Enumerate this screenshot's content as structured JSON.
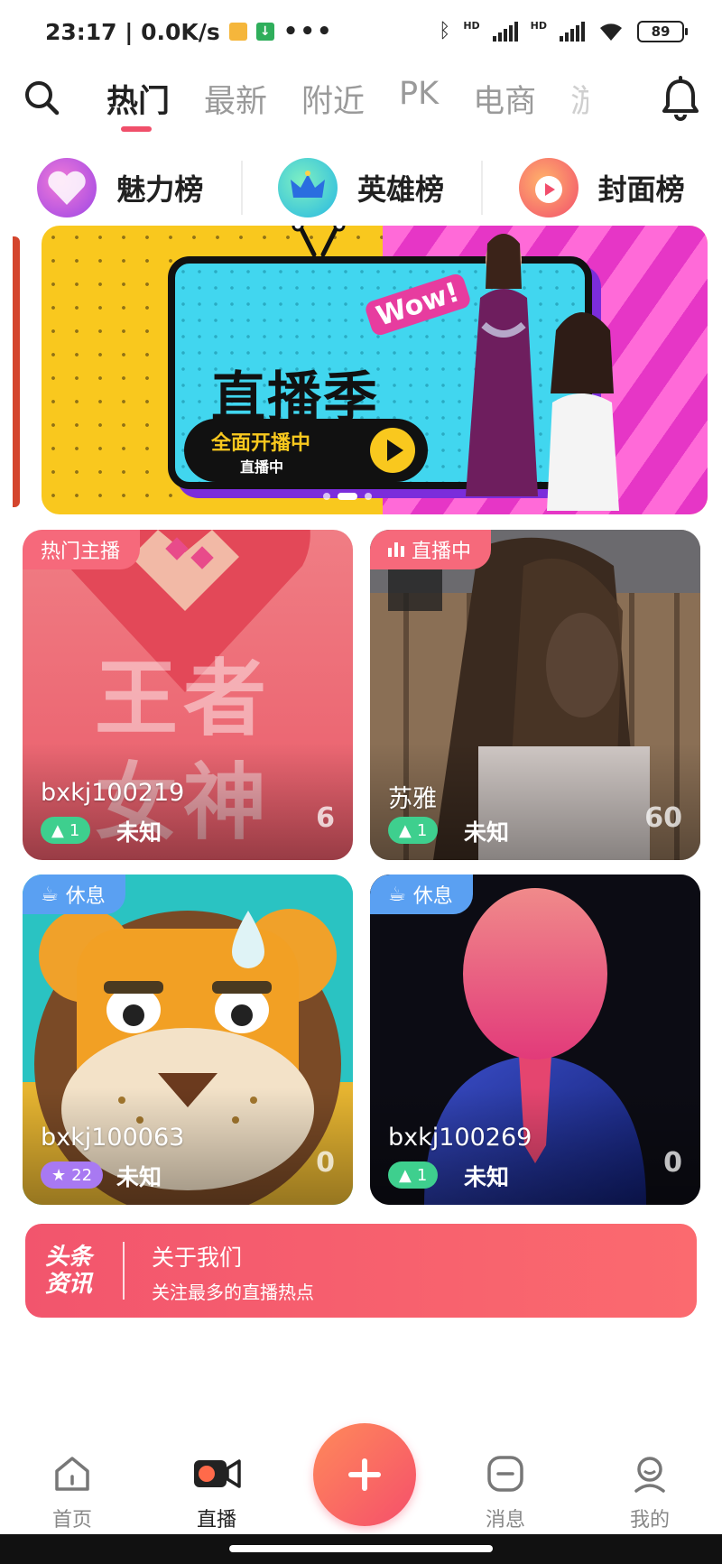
{
  "status_bar": {
    "time_speed": "23:17 | 0.0K/s",
    "hd1": "HD",
    "hd2": "HD",
    "battery": "89"
  },
  "top_tabs": [
    {
      "label": "热门",
      "active": true
    },
    {
      "label": "最新"
    },
    {
      "label": "附近"
    },
    {
      "label": "PK"
    },
    {
      "label": "电商"
    },
    {
      "label": "游"
    }
  ],
  "rank_bar": [
    {
      "label": "魅力榜",
      "icon": "heart-icon"
    },
    {
      "label": "英雄榜",
      "icon": "crown-icon"
    },
    {
      "label": "封面榜",
      "icon": "play-icon"
    }
  ],
  "banner": {
    "wow": "Wow!",
    "title": "直播季",
    "pill_main": "全面开播中",
    "pill_sub": "直播中"
  },
  "cards": [
    {
      "tag": "热门主播",
      "tag_type": "hot",
      "name": "bxkj100219",
      "level": "1",
      "location": "未知",
      "count": "6",
      "art_text_line1": "王者",
      "art_text_line2": "女神"
    },
    {
      "tag": "直播中",
      "tag_type": "hot",
      "name": "苏雅",
      "level": "1",
      "location": "未知",
      "count": "60"
    },
    {
      "tag": "休息",
      "tag_type": "rest",
      "name": "bxkj100063",
      "level": "22",
      "location": "未知",
      "count": "0"
    },
    {
      "tag": "休息",
      "tag_type": "rest",
      "name": "bxkj100269",
      "level": "1",
      "location": "未知",
      "count": "0"
    }
  ],
  "news": {
    "logo_line1": "头条",
    "logo_line2": "资讯",
    "title": "关于我们",
    "subtitle": "关注最多的直播热点"
  },
  "bottom_nav": [
    {
      "label": "首页"
    },
    {
      "label": "直播",
      "active": true
    },
    {
      "label": "消息"
    },
    {
      "label": "我的"
    }
  ],
  "colors": {
    "accent": "#f04f6a",
    "news_bg": "#f2556d",
    "rest_tag": "#5aa0f2",
    "hot_tag": "#f6697b"
  }
}
